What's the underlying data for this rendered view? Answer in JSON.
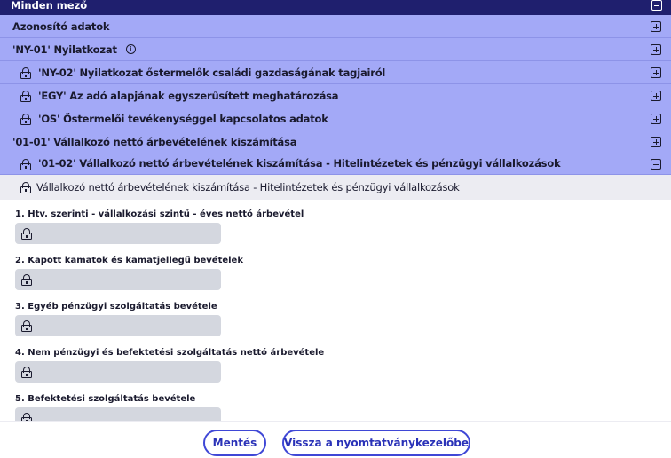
{
  "header": {
    "title": "Minden mező"
  },
  "sections": [
    {
      "label": "Azonosító adatok",
      "locked": false,
      "expanded": false
    },
    {
      "label": "'NY-01' Nyilatkozat",
      "locked": false,
      "expanded": false,
      "info": "i"
    },
    {
      "label": "'NY-02' Nyilatkozat őstermelők családi gazdaságának tagjairól",
      "locked": true,
      "expanded": false
    },
    {
      "label": "'EGY' Az adó alapjának egyszerűsített meghatározása",
      "locked": true,
      "expanded": false
    },
    {
      "label": "'OS' Őstermelői tevékenységgel kapcsolatos adatok",
      "locked": true,
      "expanded": false
    },
    {
      "label": "'01-01' Vállalkozó nettó árbevételének kiszámítása",
      "locked": false,
      "expanded": false
    },
    {
      "label": "'01-02' Vállalkozó nettó árbevételének kiszámítása - Hitelintézetek és pénzügyi vállalkozások",
      "locked": true,
      "expanded": true
    }
  ],
  "subsection": {
    "label": "Vállalkozó nettó árbevételének kiszámítása - Hitelintézetek és pénzügyi vállalkozások"
  },
  "fields": [
    {
      "label": "1. Htv. szerinti - vállalkozási szintű - éves nettó árbevétel",
      "value": ""
    },
    {
      "label": "2. Kapott kamatok és kamatjellegű bevételek",
      "value": ""
    },
    {
      "label": "3. Egyéb pénzügyi szolgáltatás bevétele",
      "value": ""
    },
    {
      "label": "4. Nem pénzügyi és befektetési szolgáltatás nettó árbevétele",
      "value": ""
    },
    {
      "label": "5. Befektetési szolgáltatás bevétele",
      "value": ""
    }
  ],
  "footer": {
    "save_label": "Mentés",
    "back_label": "Vissza a nyomtatványkezelőbe"
  },
  "colors": {
    "header_bg": "#1f1f6e",
    "section_bg": "#a3a9f7",
    "subheader_bg": "#ececf2",
    "input_bg": "#d4d7df",
    "accent": "#3f47d6"
  }
}
